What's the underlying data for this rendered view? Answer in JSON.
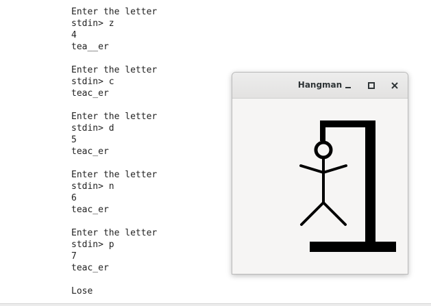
{
  "terminal": {
    "lines": [
      "Enter the letter",
      "stdin> z",
      "4",
      "tea__er",
      "",
      "Enter the letter",
      "stdin> c",
      "teac_er",
      "",
      "Enter the letter",
      "stdin> d",
      "5",
      "teac_er",
      "",
      "Enter the letter",
      "stdin> n",
      "6",
      "teac_er",
      "",
      "Enter the letter",
      "stdin> p",
      "7",
      "teac_er",
      "",
      "Lose"
    ]
  },
  "window": {
    "title": "Hangman",
    "buttons": [
      "minimize-icon",
      "maximize-icon",
      "close-icon"
    ]
  },
  "colors": {
    "drawing": "#000000",
    "window_bg": "#f6f5f4",
    "titlebar_text": "#2e3436"
  }
}
